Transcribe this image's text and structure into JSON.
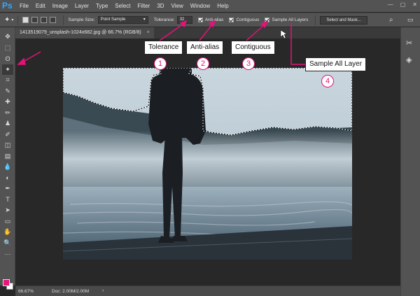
{
  "app": {
    "logo": "Ps",
    "menu": [
      "File",
      "Edit",
      "Image",
      "Layer",
      "Type",
      "Select",
      "Filter",
      "3D",
      "View",
      "Window",
      "Help"
    ],
    "window_controls": [
      "—",
      "▢",
      "✕"
    ]
  },
  "options": {
    "sample_size_label": "Sample Size:",
    "sample_size_value": "Point Sample",
    "tolerance_label": "Tolerance:",
    "tolerance_value": "32",
    "anti_alias_label": "Anti-alias",
    "contiguous_label": "Contiguous",
    "sample_all_label": "Sample All Layers",
    "select_mask_label": "Select and Mask..."
  },
  "document": {
    "tab_title": "1413519079_unsplash-1024x682.jpg @ 66.7% (RGB/8)",
    "tab_close": "×"
  },
  "status": {
    "zoom": "66.67%",
    "doc_info": "Doc: 2.00M/2.00M",
    "arrow": "›"
  },
  "callouts": [
    {
      "label": "Tolerance",
      "num": "1"
    },
    {
      "label": "Anti-alias",
      "num": "2"
    },
    {
      "label": "Contiguous",
      "num": "3"
    },
    {
      "label": "Sample All Layer",
      "num": "4"
    }
  ],
  "colors": {
    "accent": "#e4127a",
    "foreground_swatch": "#e6177a",
    "background_swatch": "#ffffff",
    "ps_blue": "#31a8ff"
  },
  "tools": [
    "move-icon",
    "marquee-icon",
    "lasso-icon",
    "magic-wand-icon",
    "crop-icon",
    "eyedropper-icon",
    "healing-icon",
    "brush-icon",
    "stamp-icon",
    "history-brush-icon",
    "eraser-icon",
    "gradient-icon",
    "blur-icon",
    "dodge-icon",
    "pen-icon",
    "type-icon",
    "path-select-icon",
    "shape-icon",
    "hand-icon",
    "zoom-icon",
    "more-icon"
  ],
  "tool_glyphs": [
    "✥",
    "⬚",
    "ʘ",
    "✦",
    "⌗",
    "✎",
    "✚",
    "✏",
    "♟",
    "✐",
    "◫",
    "▤",
    "💧",
    "◐",
    "✒",
    "T",
    "➤",
    "▭",
    "✋",
    "🔍",
    "···"
  ]
}
